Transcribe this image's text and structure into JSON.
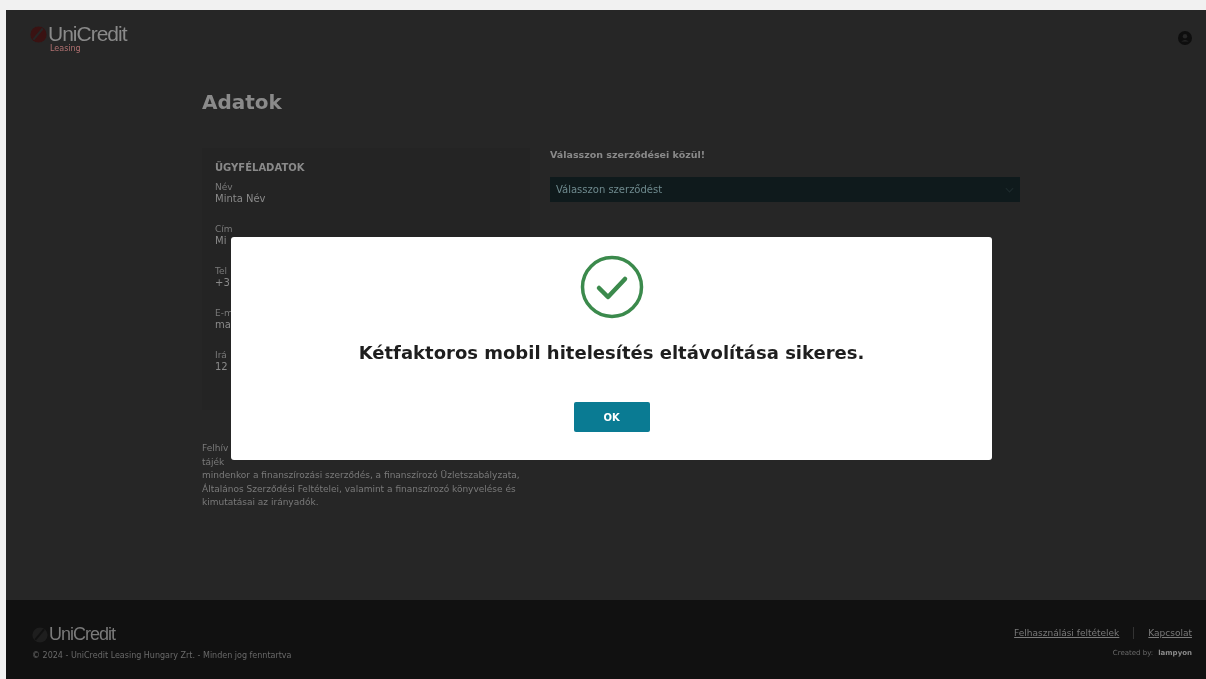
{
  "header": {
    "logo": "UniCredit",
    "logo_sub": "Leasing"
  },
  "page_title": "Adatok",
  "customer_card": {
    "heading": "ÜGYFÉLADATOK",
    "fields": [
      {
        "label": "Név",
        "value": "Minta Név"
      },
      {
        "label": "Cím",
        "value": "Mi"
      },
      {
        "label": "Tel",
        "value": "+3"
      },
      {
        "label": "E-m",
        "value": "ma"
      },
      {
        "label": "Irá",
        "value": "12"
      }
    ]
  },
  "notice": {
    "lines": [
      "Felhív",
      "tájék",
      "mindenkor a finanszírozási szerződés, a finanszírozó Üzletszabályzata,",
      "Általános Szerződési Feltételei, valamint a finanszírozó könyvelése és",
      "kimutatásai az irányadók."
    ]
  },
  "contract_select": {
    "label": "Válasszon szerződései közül!",
    "placeholder": "Válasszon szerződést"
  },
  "modal": {
    "message": "Kétfaktoros mobil hitelesítés eltávolítása sikeres.",
    "button": "OK"
  },
  "footer": {
    "logo": "UniCredit",
    "copyright": "© 2024 - UniCredit Leasing Hungary Zrt. - Minden jog fenntartva",
    "links": [
      "Felhasználási feltételek",
      "Kapcsolat"
    ],
    "credit_label": "Created by:",
    "credit": "lampyon"
  }
}
